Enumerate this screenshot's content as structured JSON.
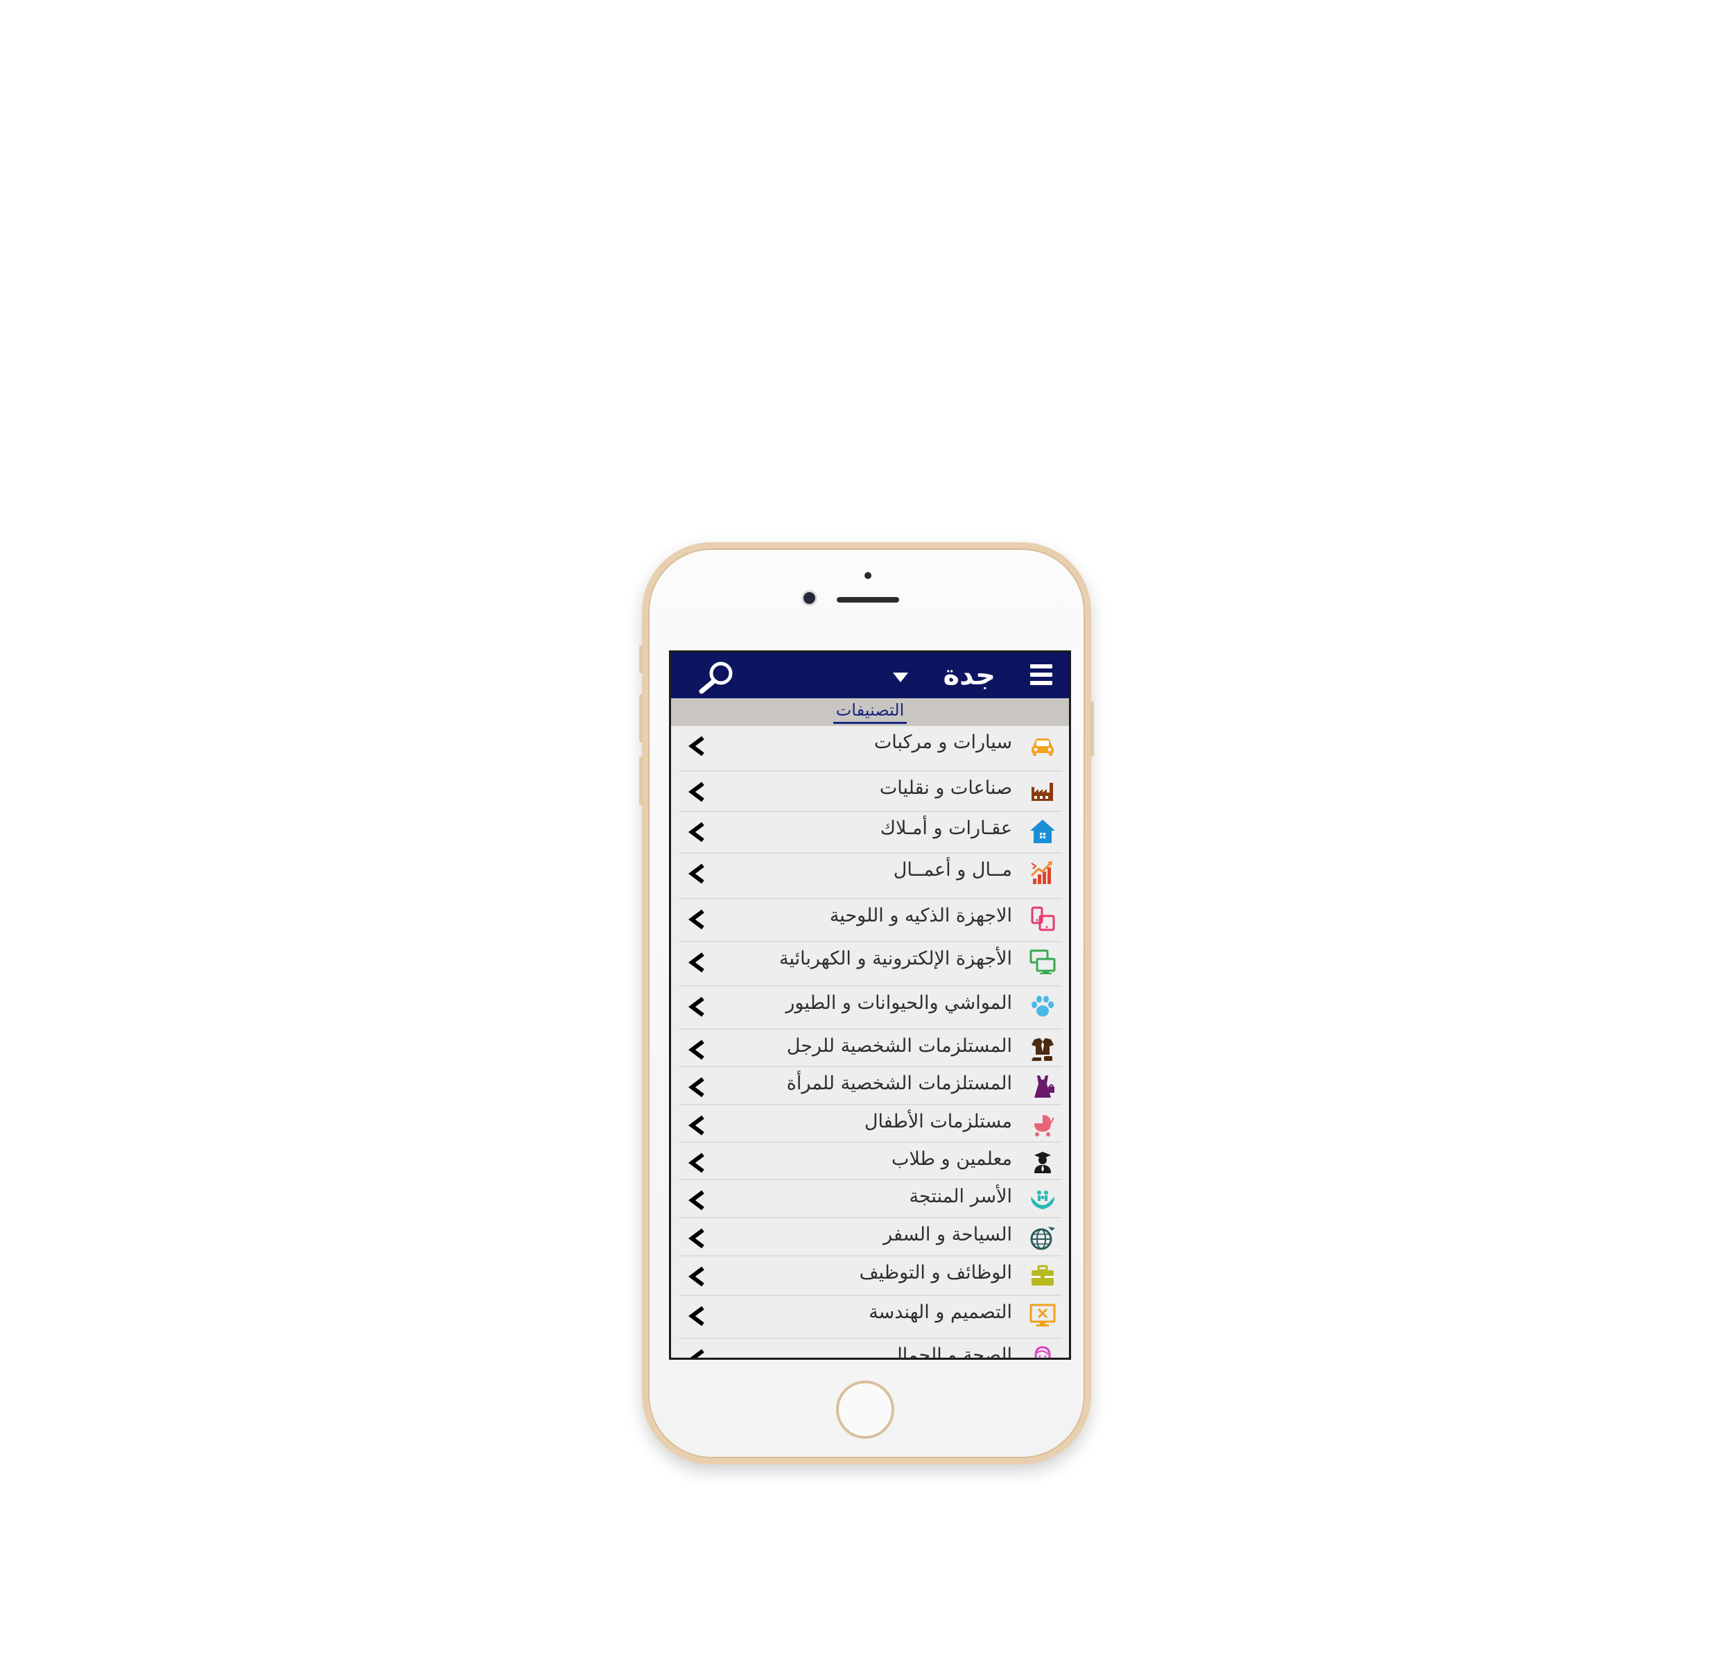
{
  "header": {
    "city": "جدة",
    "menu_icon": "hamburger-menu-icon",
    "search_icon": "search-icon",
    "dropdown_icon": "caret-down-icon"
  },
  "tabs": {
    "active": "التصنيفات"
  },
  "categories": [
    {
      "label": "سيارات و مركبات",
      "icon": "car-icon",
      "color": "#f4a21e"
    },
    {
      "label": "صناعات و نقليات",
      "icon": "factory-icon",
      "color": "#8b3a10"
    },
    {
      "label": "عقـارات و أمـلاك",
      "icon": "house-icon",
      "color": "#1a8fd6"
    },
    {
      "label": "مــال و أعمــال",
      "icon": "growth-chart-icon",
      "color": "#e0452a"
    },
    {
      "label": "الاجهزة الذكيه و اللوحية",
      "icon": "devices-icon",
      "color": "#e63a6e"
    },
    {
      "label": "الأجهزة الإلكترونية و الكهربائية",
      "icon": "monitor-icon",
      "color": "#3aa852"
    },
    {
      "label": "المواشي والحيوانات و الطيور",
      "icon": "paw-icon",
      "color": "#4ab8e8"
    },
    {
      "label": "المستلزمات الشخصية للرجل",
      "icon": "menswear-icon",
      "color": "#4a2a12"
    },
    {
      "label": "المستلزمات الشخصية للمرأة",
      "icon": "dress-icon",
      "color": "#6a1a6a"
    },
    {
      "label": "مستلزمات الأطفال",
      "icon": "stroller-icon",
      "color": "#e8647a"
    },
    {
      "label": "معلمين و طلاب",
      "icon": "graduate-icon",
      "color": "#1a1a1a"
    },
    {
      "label": "الأسر المنتجة",
      "icon": "family-hands-icon",
      "color": "#2ab8b8"
    },
    {
      "label": "السياحة و السفر",
      "icon": "globe-plane-icon",
      "color": "#2a5a5a"
    },
    {
      "label": "الوظائف و التوظيف",
      "icon": "briefcase-icon",
      "color": "#b8b820"
    },
    {
      "label": "التصميم و الهندسة",
      "icon": "design-screen-icon",
      "color": "#f0a020"
    },
    {
      "label": "الصحة و الجمال",
      "icon": "beauty-face-icon",
      "color": "#e040c8"
    }
  ],
  "colors": {
    "header_bg": "#0d1560",
    "tab_bar_bg": "#c9c6c2",
    "list_bg": "#eeeeee",
    "frame_gold": "#e7cfb0"
  }
}
